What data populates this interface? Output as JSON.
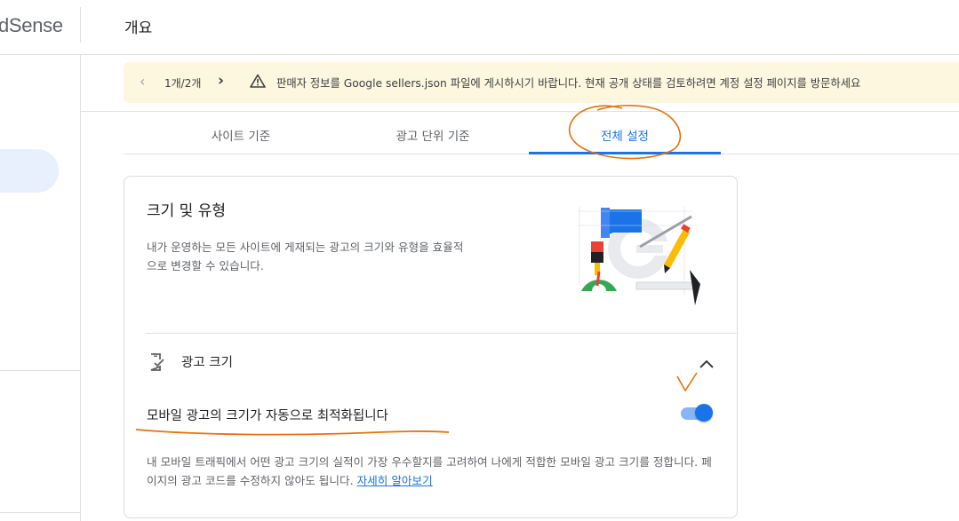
{
  "app": {
    "logo_text": "dSense",
    "page_title": "개요"
  },
  "notice": {
    "pager": "1개/2개",
    "message": "판매자 정보를 Google sellers.json 파일에 게시하시기 바랍니다. 현재 공개 상태를 검토하려면 계정 설정 페이지를 방문하세요"
  },
  "tabs": [
    {
      "label": "사이트 기준"
    },
    {
      "label": "광고 단위 기준"
    },
    {
      "label": "전체 설정",
      "active": true
    }
  ],
  "card": {
    "title": "크기 및 유형",
    "description": "내가 운영하는 모든 사이트에 게재되는 광고의 크기와 유형을 효율적으로 변경할 수 있습니다.",
    "section": {
      "title": "광고 크기",
      "expanded": true,
      "setting": {
        "label": "모바일 광고의 크기가 자동으로 최적화됩니다",
        "enabled": true,
        "description": "내 모바일 트래픽에서 어떤 광고 크기의 실적이 가장 우수할지를 고려하여 나에게 적합한 모바일 광고 크기를 정합니다. 페이지의 광고 코드를 수정하지 않아도 됩니다. ",
        "learn_more": "자세히 알아보기"
      }
    }
  },
  "colors": {
    "accent": "#1a73e8",
    "notice_bg": "#fef7e0",
    "annotation": "#e8710a"
  },
  "icons": {
    "prev": "chevron-left-icon",
    "next": "chevron-right-icon",
    "warning": "warning-icon",
    "section": "mobile-check-icon",
    "collapse": "chevron-up-icon"
  }
}
